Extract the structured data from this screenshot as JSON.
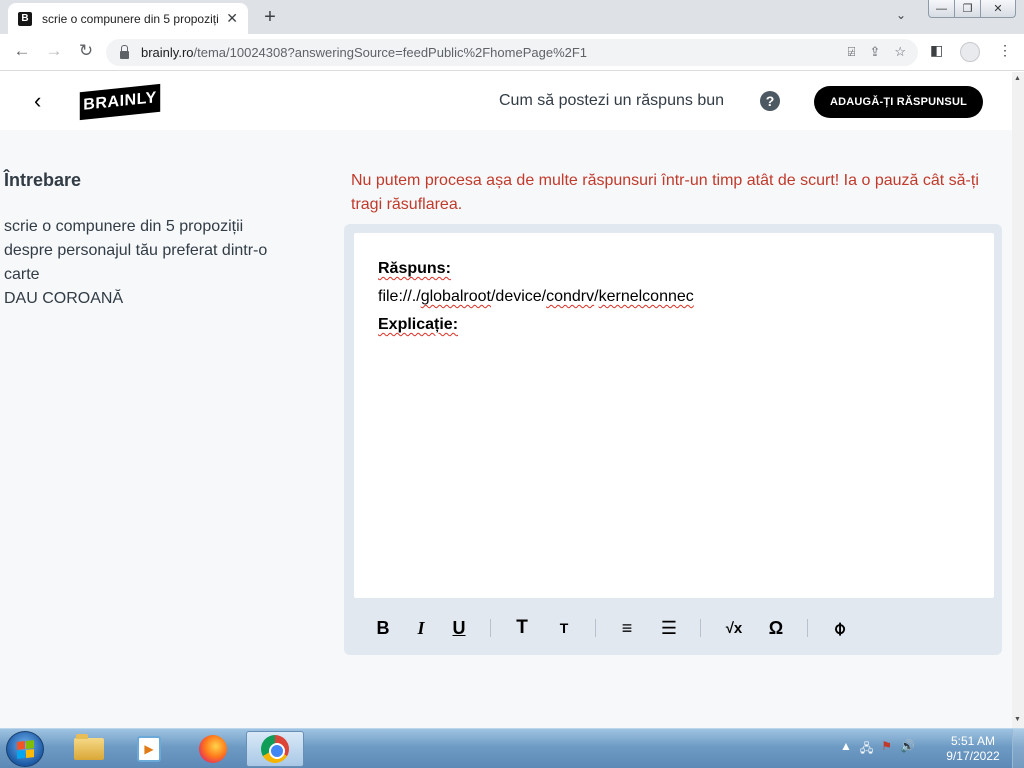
{
  "browser": {
    "tab_title": "scrie o compunere din 5 propoziții",
    "tab_favicon": "B",
    "tab_close": "✕",
    "new_tab": "+",
    "tab_search": "⌄",
    "url_domain": "brainly.ro",
    "url_path": "/tema/10024308?answeringSource=feedPublic%2FhomePage%2F1",
    "win_min": "—",
    "win_max": "❐",
    "win_close": "✕"
  },
  "header": {
    "back": "‹",
    "logo_text": "BRAINLY",
    "how_to": "Cum să postezi un răspuns bun",
    "help": "?",
    "add_answer": "ADAUGĂ-ȚI RĂSPUNSUL"
  },
  "question": {
    "heading": "Întrebare",
    "lines": [
      "scrie o compunere din 5 propoziții",
      "despre personajul tău preferat dintr-o",
      "carte",
      "DAU COROANĂ"
    ]
  },
  "warning": "Nu putem procesa așa de multe răspunsuri într-un timp atât de scurt! Ia o pauză cât să-ți tragi răsuflarea.",
  "editor": {
    "answer_label": "Răspuns:",
    "answer_parts": [
      "file://./",
      "globalroot",
      "/device/",
      "condrv",
      "/",
      "kernelconnec"
    ],
    "explanation_label": "Explicație:"
  },
  "formatting": {
    "bold": "B",
    "italic": "I",
    "underline": "U",
    "heading_large": "T",
    "heading_small": "T",
    "ordered_list": "≡",
    "bullet_list": "☰",
    "math": "√x",
    "symbol": "Ω",
    "attach": "⌀"
  },
  "taskbar": {
    "time": "5:51 AM",
    "date": "9/17/2022",
    "tray_arrow": "▲"
  }
}
